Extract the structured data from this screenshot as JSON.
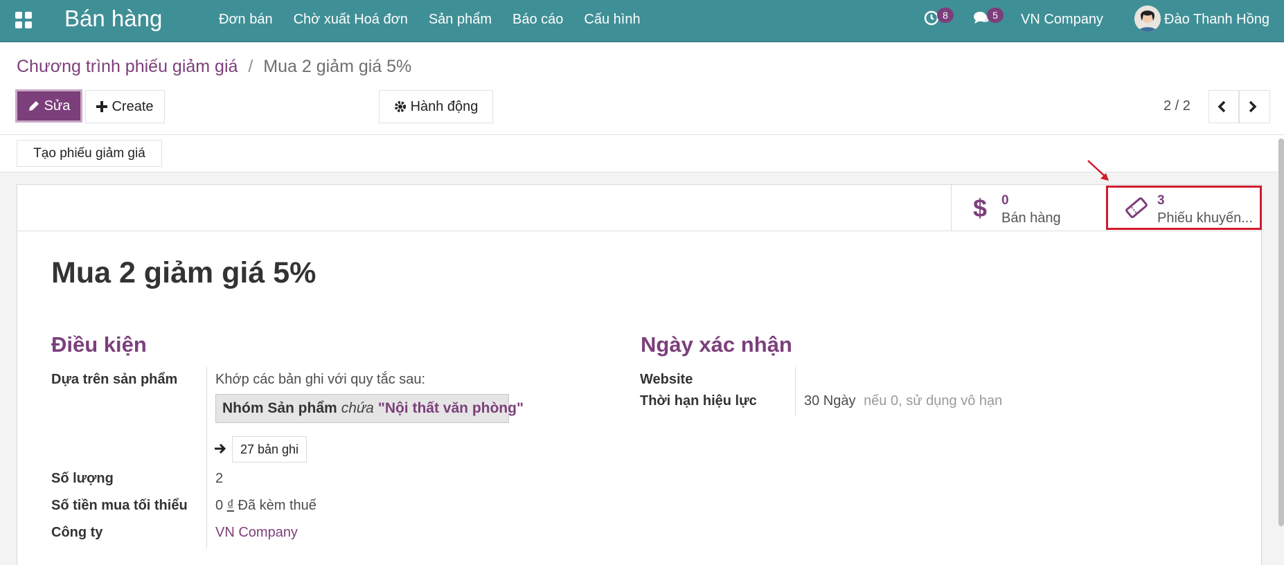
{
  "navbar": {
    "app_title": "Bán hàng",
    "menu": [
      "Đơn bán",
      "Chờ xuất Hoá đơn",
      "Sản phẩm",
      "Báo cáo",
      "Cấu hình"
    ],
    "activity_count": "8",
    "message_count": "5",
    "company": "VN Company",
    "user": "Đào Thanh Hồng",
    "icons": [
      "apps-grid-icon",
      "activity-clock-icon",
      "chat-bubbles-icon"
    ]
  },
  "breadcrumb": {
    "parent": "Chương trình phiếu giảm giá",
    "separator": "/",
    "current": "Mua 2 giảm giá 5%"
  },
  "control": {
    "edit_label": "Sửa",
    "create_label": "Create",
    "action_label": "Hành động",
    "pager": "2 / 2"
  },
  "statusbar": {
    "generate_label": "Tạo phiếu giảm giá"
  },
  "smart_buttons": [
    {
      "value": "0",
      "label": "Bán hàng",
      "icon": "dollar-icon"
    },
    {
      "value": "3",
      "label": "Phiếu khuyến...",
      "icon": "ticket-icon"
    }
  ],
  "record": {
    "title": "Mua 2 giảm giá 5%"
  },
  "conditions": {
    "title": "Điều kiện",
    "based_on_product_label": "Dựa trên sản phẩm",
    "rule_intro": "Khớp các bản ghi với quy tắc sau:",
    "domain_field": "Nhóm Sản phẩm",
    "domain_operator": "chứa",
    "domain_value": "\"Nội thất văn phòng\"",
    "records_count": "27 bản ghi",
    "quantity_label": "Số lượng",
    "quantity_value": "2",
    "min_amount_label": "Số tiền mua tối thiểu",
    "min_amount_value": "0",
    "currency": "₫",
    "tax_note": "Đã kèm thuế",
    "company_label": "Công ty",
    "company_value": "VN Company"
  },
  "validity": {
    "title": "Ngày xác nhận",
    "website_label": "Website",
    "validity_label": "Thời hạn hiệu lực",
    "validity_value": "30 Ngày",
    "validity_hint": "nếu 0, sử dụng vô hạn"
  },
  "colors": {
    "navbar": "#3f8f96",
    "brand": "#7c3f7b",
    "highlight": "#d11a2a"
  }
}
